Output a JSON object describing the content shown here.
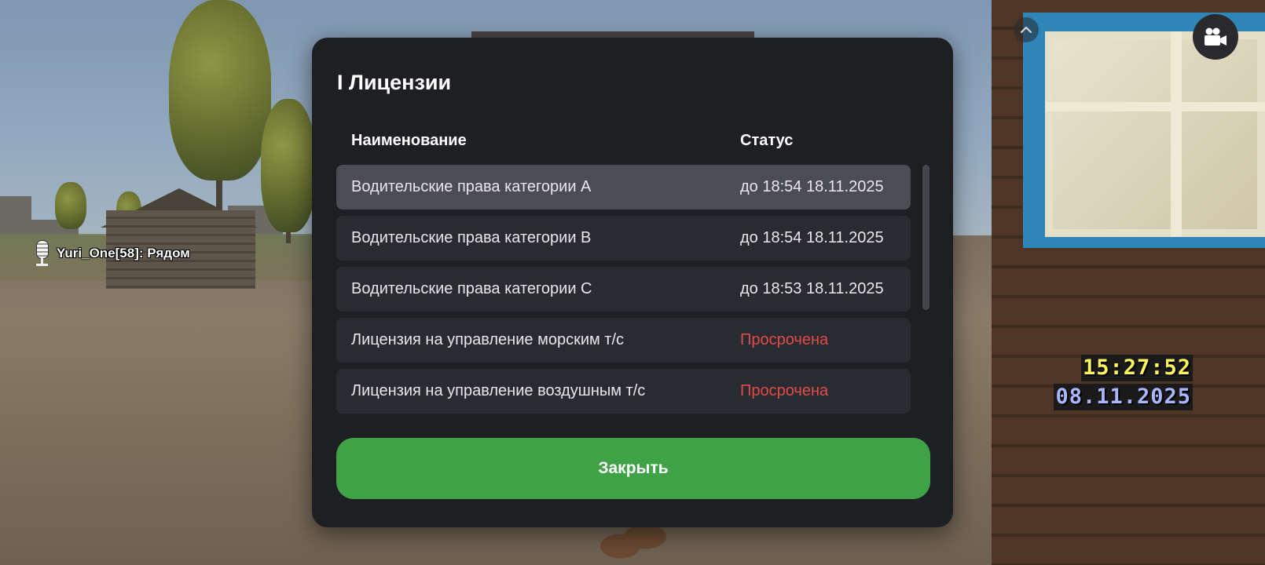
{
  "modal": {
    "title": "I Лицензии",
    "columns": {
      "name": "Наименование",
      "status": "Статус"
    },
    "licenses": [
      {
        "name": "Водительские права категории A",
        "status": "до 18:54 18.11.2025",
        "expired": false,
        "selected": true
      },
      {
        "name": "Водительские права категории B",
        "status": "до 18:54 18.11.2025",
        "expired": false,
        "selected": false
      },
      {
        "name": "Водительские права категории C",
        "status": "до 18:53 18.11.2025",
        "expired": false,
        "selected": false
      },
      {
        "name": "Лицензия на управление морским т/с",
        "status": "Просрочена",
        "expired": true,
        "selected": false
      },
      {
        "name": "Лицензия на управление воздушным т/с",
        "status": "Просрочена",
        "expired": true,
        "selected": false
      }
    ],
    "close_label": "Закрыть"
  },
  "hud": {
    "voice_chat": "Yuri_One[58]: Рядом",
    "time": "15:27:52",
    "date": "08.11.2025",
    "camera_icon": "video-camera-icon",
    "collapse_icon": "chevron-up-icon"
  },
  "colors": {
    "panel": "#1e1f23",
    "row": "#2a2b30",
    "row_selected": "#4b4c54",
    "expired": "#e04b4b",
    "accent_green": "#40a247",
    "time_yellow": "#fff45a",
    "date_blue": "#aab6ff"
  }
}
